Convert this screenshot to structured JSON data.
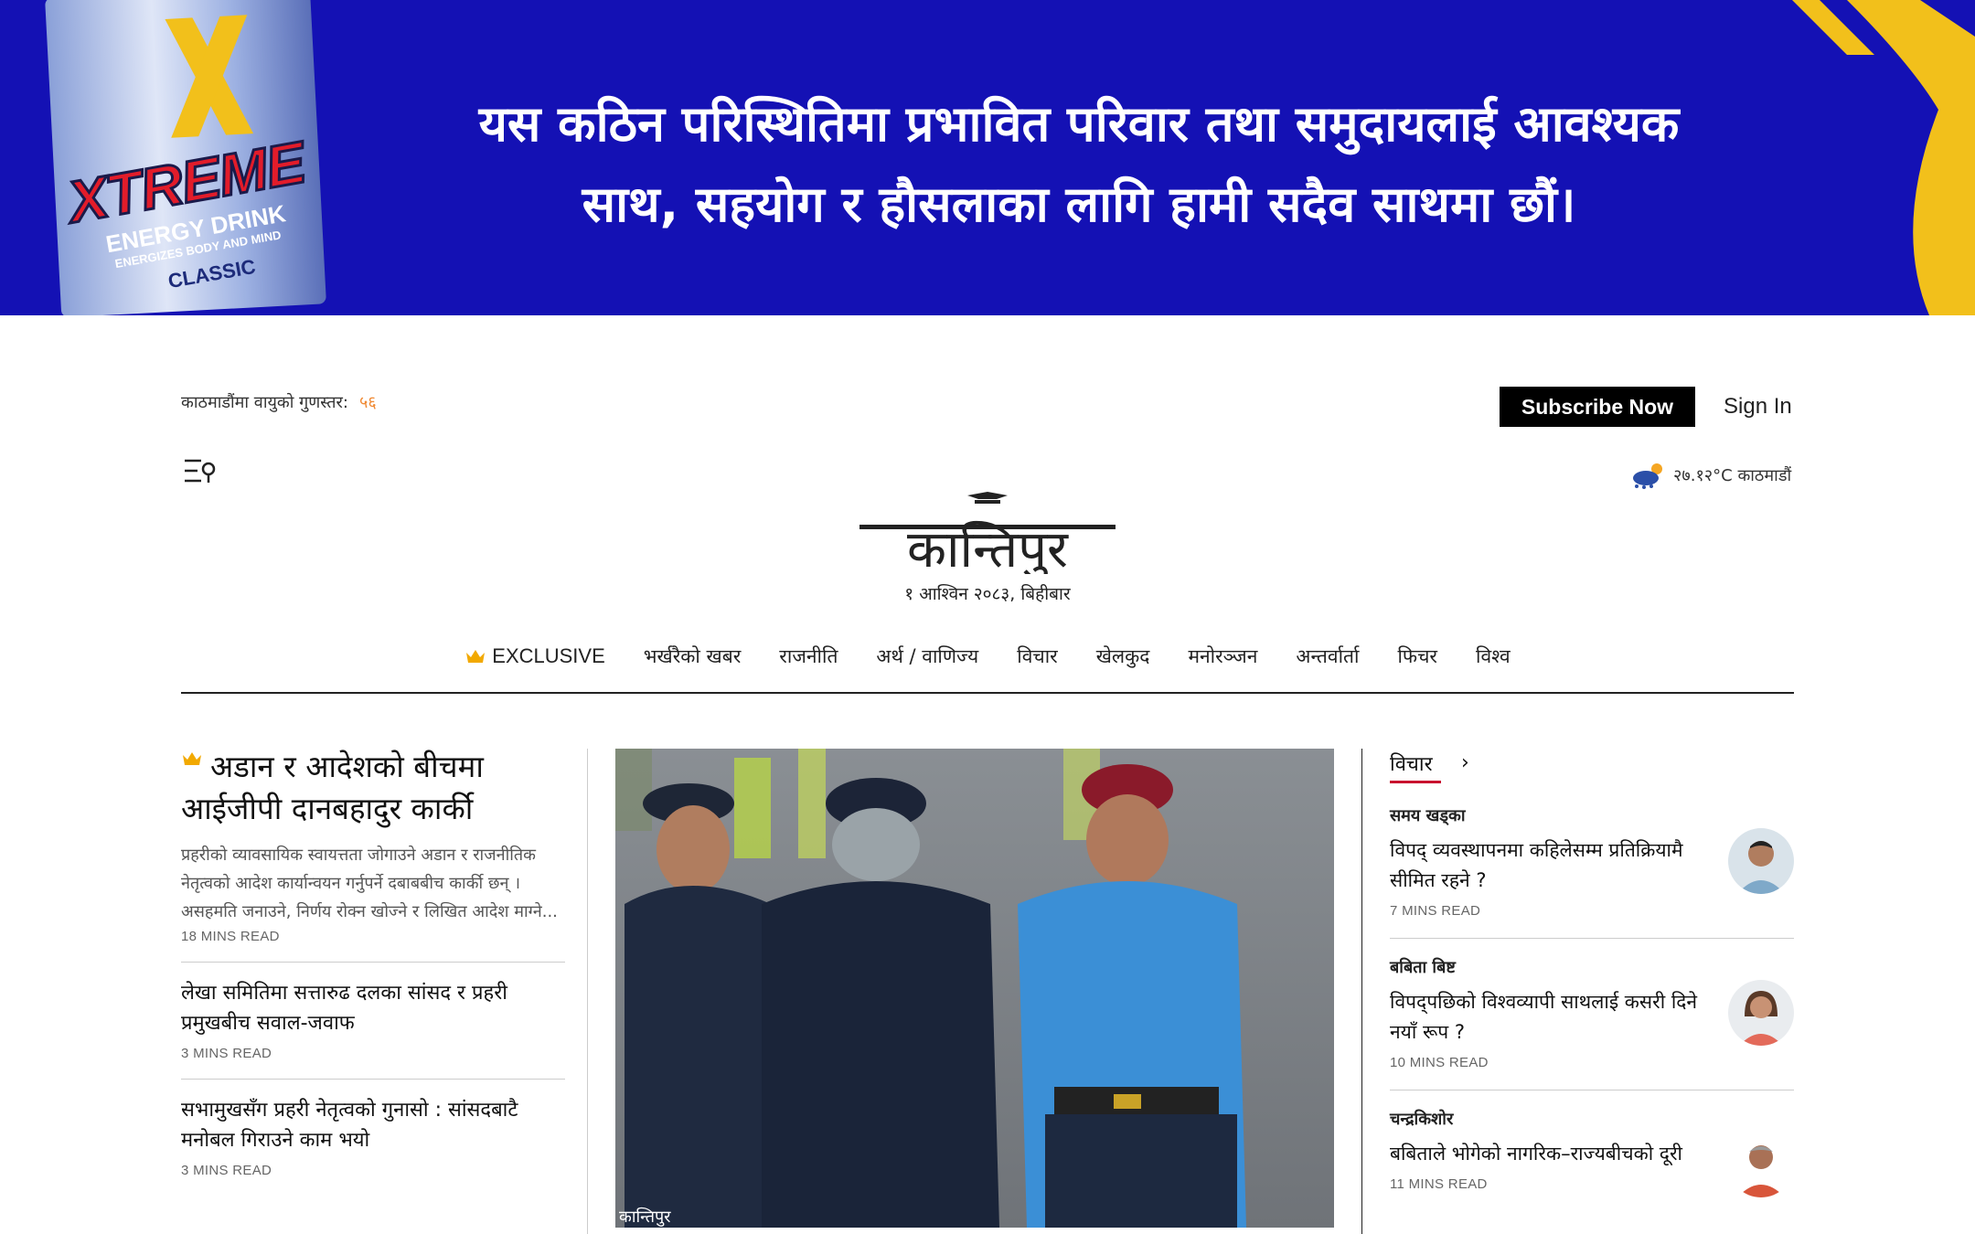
{
  "banner": {
    "brand": "XTREME",
    "tagline": "ENERGY DRINK",
    "sub": "ENERGIZES BODY AND MIND",
    "variant": "CLASSIC",
    "message_line1": "यस कठिन परिस्थितिमा प्रभावित परिवार तथा समुदायलाई आवश्यक",
    "message_line2": "साथ, सहयोग र हौसलाका लागि हामी सदैव साथमा छौं।",
    "bg_color": "#1411b4"
  },
  "header": {
    "aqi_label": "काठमाडौंमा वायुको गुणस्तर:",
    "aqi_value": "५६",
    "subscribe_label": "Subscribe Now",
    "signin_label": "Sign In",
    "weather": "२७.१२°C काठमाडौं",
    "logo_text": "कान्तिपुर",
    "date": "१ आश्विन २०८३, बिहीबार"
  },
  "nav": {
    "items": [
      "EXCLUSIVE",
      "भर्खरैको खबर",
      "राजनीति",
      "अर्थ / वाणिज्य",
      "विचार",
      "खेलकुद",
      "मनोरञ्जन",
      "अन्तर्वार्ता",
      "फिचर",
      "विश्व"
    ]
  },
  "lead": {
    "title": "अडान र आदेशको बीचमा आईजीपी दानबहादुर कार्की",
    "summary": "प्रहरीको व्यावसायिक स्वायत्तता जोगाउने अडान र राजनीतिक नेतृत्वको आदेश कार्यान्वयन गर्नुपर्ने दबाबबीच कार्की छन् । असहमति जनाउने, निर्णय रोक्न खोज्ने र लिखित आदेश माग्ने...",
    "read_time": "18 MINS READ"
  },
  "stories": [
    {
      "title": "लेखा समितिमा सत्तारुढ दलका सांसद र प्रहरी प्रमुखबीच सवाल-जवाफ",
      "read_time": "3 MINS READ"
    },
    {
      "title": "सभामुखसँग प्रहरी नेतृत्वको गुनासो : सांसदबाटै मनोबल गिराउने काम भयो",
      "read_time": "3 MINS READ"
    }
  ],
  "photo": {
    "watermark": "कान्तिपुर"
  },
  "opinion": {
    "heading": "विचार",
    "items": [
      {
        "author": "समय खड्का",
        "title": "विपद् व्यवस्थापनमा कहिलेसम्म प्रतिक्रियामै सीमित रहने ?",
        "read_time": "7 MINS READ"
      },
      {
        "author": "बबिता बिष्ट",
        "title": "विपद्पछिको विश्वव्यापी साथलाई कसरी दिने नयाँ रूप ?",
        "read_time": "10 MINS READ"
      },
      {
        "author": "चन्द्रकिशोर",
        "title": "बबिताले भोगेको नागरिक–राज्यबीचको दूरी",
        "read_time": "11 MINS READ"
      }
    ]
  }
}
